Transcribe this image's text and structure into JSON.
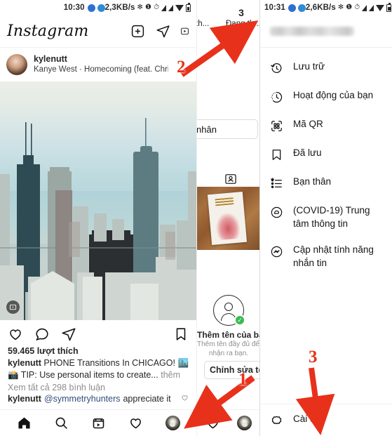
{
  "left": {
    "statusbar": {
      "time": "10:30",
      "network": "2,3KB/s"
    },
    "app_title": "Instagram",
    "header_icons": [
      "add-post-icon",
      "direct-message-icon",
      "igtv-icon"
    ],
    "post": {
      "username": "kylenutt",
      "music": "Kanye West · Homecoming (feat. Chris M...",
      "likes": "59.465 lượt thích",
      "caption_user": "kylenutt",
      "caption_text": "PHONE Transitions In CHICAGO! 🏙️ 📸 TIP: Use personal items to create...",
      "caption_more": "thêm",
      "comments_link": "Xem tất cả 298 bình luận",
      "comment_user": "kylenutt",
      "comment_mention": "@symmetryhunters",
      "comment_text": "appreciate it"
    },
    "tabbar": [
      "home-icon",
      "search-icon",
      "reels-icon",
      "activity-heart-icon",
      "profile-avatar"
    ]
  },
  "middle": {
    "stats": [
      {
        "value": "",
        "label": "th..."
      },
      {
        "value": "3",
        "label": "Đang th..."
      }
    ],
    "pro_button": "nhân",
    "add_name_title": "Thêm tên của bạ",
    "add_name_sub1": "Thêm tên đầy đủ để bạ",
    "add_name_sub2": "nhận ra bạn.",
    "edit_button": "Chỉnh sửa tên"
  },
  "right": {
    "statusbar": {
      "time": "10:31",
      "network": "2,6KB/s"
    },
    "username_blurred": "",
    "menu_items": [
      {
        "icon": "archive-clock-icon",
        "label": "Lưu trữ"
      },
      {
        "icon": "activity-clock-icon",
        "label": "Hoạt động của bạn"
      },
      {
        "icon": "qr-code-icon",
        "label": "Mã QR"
      },
      {
        "icon": "bookmark-icon",
        "label": "Đã lưu"
      },
      {
        "icon": "close-friends-list-icon",
        "label": "Bạn thân"
      },
      {
        "icon": "covid-info-icon",
        "label": "(COVID-19) Trung tâm thông tin"
      },
      {
        "icon": "messenger-icon",
        "label": "Cập nhật tính năng nhắn tin"
      }
    ],
    "settings": {
      "icon": "gear-icon",
      "label": "Cài đặt"
    }
  },
  "annotations": {
    "step1": "1",
    "step2": "2",
    "step3": "3",
    "color": "#e8311b"
  }
}
